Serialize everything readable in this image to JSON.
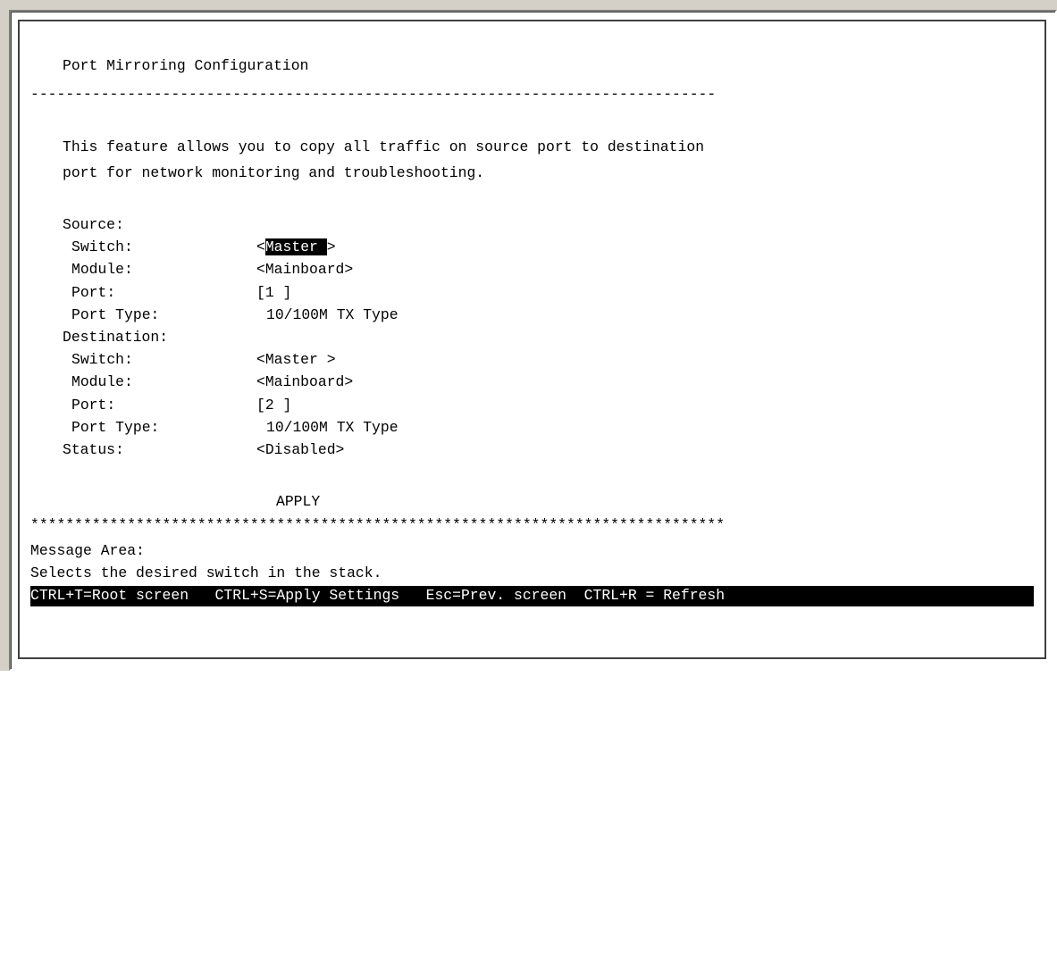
{
  "screen": {
    "title": "Port Mirroring Configuration",
    "divider_dashes": "------------------------------------------------------------------------------",
    "description_line1": "This feature allows you to copy all traffic on source port to destination",
    "description_line2": "port for network monitoring and troubleshooting."
  },
  "source": {
    "heading": "Source:",
    "switch_label": "Switch:",
    "switch_open": "<",
    "switch_value": "Master ",
    "switch_close": ">",
    "module_label": "Module:",
    "module_value": "<Mainboard>",
    "port_label": "Port:",
    "port_value": "[1 ]",
    "port_type_label": "Port Type:",
    "port_type_value": "10/100M TX Type"
  },
  "destination": {
    "heading": "Destination:",
    "switch_label": "Switch:",
    "switch_value": "<Master >",
    "module_label": "Module:",
    "module_value": "<Mainboard>",
    "port_label": "Port:",
    "port_value": "[2 ]",
    "port_type_label": "Port Type:",
    "port_type_value": "10/100M TX Type"
  },
  "status": {
    "label": "Status:",
    "value": "<Disabled>"
  },
  "apply_label": "APPLY",
  "divider_stars": "*******************************************************************************",
  "message_area": {
    "label": "Message Area:",
    "text": "Selects the desired switch in the stack."
  },
  "hotkeys": "CTRL+T=Root screen   CTRL+S=Apply Settings   Esc=Prev. screen  CTRL+R = Refresh"
}
